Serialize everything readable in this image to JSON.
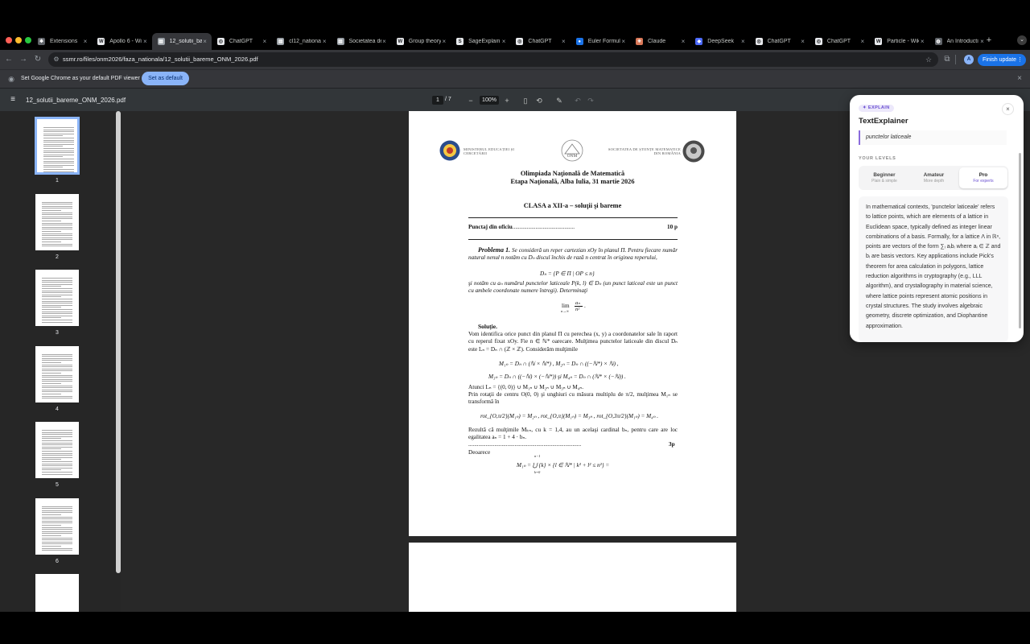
{
  "tabs": [
    {
      "title": "Extensions",
      "icon": "puzzle-icon",
      "active": false
    },
    {
      "title": "Apollo 6 - Wi",
      "icon": "wikipedia-icon",
      "active": false
    },
    {
      "title": "12_solutii_ba",
      "icon": "pdf-icon",
      "active": true
    },
    {
      "title": "ChatGPT",
      "icon": "chatgpt-icon",
      "active": false
    },
    {
      "title": "cl12_nationa",
      "icon": "pdf-icon",
      "active": false
    },
    {
      "title": "Societatea de",
      "icon": "pdf-icon",
      "active": false
    },
    {
      "title": "Group theory",
      "icon": "wikipedia-icon",
      "active": false
    },
    {
      "title": "SageExplain",
      "icon": "sage-icon",
      "active": false
    },
    {
      "title": "ChatGPT",
      "icon": "chatgpt-icon",
      "active": false
    },
    {
      "title": "Euler Formul",
      "icon": "site-icon",
      "active": false
    },
    {
      "title": "Claude",
      "icon": "claude-icon",
      "active": false
    },
    {
      "title": "DeepSeek",
      "icon": "deepseek-icon",
      "active": false
    },
    {
      "title": "ChatGPT",
      "icon": "chatgpt-icon",
      "active": false
    },
    {
      "title": "ChatGPT",
      "icon": "chatgpt-icon",
      "active": false
    },
    {
      "title": "Particle - Wik",
      "icon": "wikipedia-icon",
      "active": false
    },
    {
      "title": "An Introducti",
      "icon": "globe-icon",
      "active": false
    }
  ],
  "toolbar": {
    "url": "ssmr.ro/files/onm2026/faza_nationala/12_solutii_bareme_ONM_2026.pdf",
    "finish_update": "Finish update",
    "profile_initial": "A"
  },
  "infobar": {
    "text": "Set Google Chrome as your default PDF viewer",
    "button": "Set as default"
  },
  "pdf": {
    "filename": "12_solutii_bareme_ONM_2026.pdf",
    "page_current": "1",
    "page_total": "/ 7",
    "zoom": "100%",
    "thumbnails": [
      "1",
      "2",
      "3",
      "4",
      "5",
      "6"
    ]
  },
  "document": {
    "ministry": "MINISTERUL EDUCAȚIEI ȘI CERCETĂRII",
    "society": "SOCIETATEA DE ȘTIINȚE MATEMATICE DIN ROMÂNIA",
    "onm_logo": "ONM",
    "title1": "Olimpiada Naţională de Matematică",
    "title2": "Etapa Naţională, Alba Iulia, 31 martie 2026",
    "class_title": "CLASA a XII-a – soluţii şi bareme",
    "oficiu": "Punctaj din oficiu",
    "oficiu_dots": "...........................................",
    "oficiu_pts": "10 p",
    "problem_label": "Problema 1.",
    "problem_text": "Se consideră un reper cartezian xOy în planul Π. Pentru fiecare număr natural nenul n notăm cu Dₙ discul închis de rază n centrat în originea reperului,",
    "problem_eq": "Dₙ = {P ∈ Π | OP ≤ n}",
    "problem_text2": "şi notăm cu aₙ numărul punctelor laticeale P(k, l) ∈ Dₙ (un punct laticeal este un punct cu ambele coordonate numere întregi). Determinaţi",
    "problem_lim": "lim",
    "problem_lim_sub": "n→∞",
    "problem_frac_num": "aₙ",
    "problem_frac_den": "n²",
    "problem_frac_tail": ".",
    "solution_label": "Soluţie.",
    "solution_text": "Vom identifica orice punct din planul Π cu perechea (x, y) a coordonatelor sale în raport cu reperul fixat xOy. Fie n ∈ ℕ* oarecare. Mulţimea punctelor laticeale din discul Dₙ este Lₙ = Dₙ ∩ (ℤ × ℤ). Considerăm mulţimile",
    "eq_m1": "M₁ₙ = Dₙ ∩ (ℕ × ℕ*) ,        M₂ₙ = Dₙ ∩ ((−ℕ*) × ℕ) ,",
    "eq_m3": "M₃ₙ = Dₙ ∩ ((−ℕ) × (−ℕ*))   şi   M₄ₙ = Dₙ ∩ (ℕ* × (−ℕ)) .",
    "eq_l": "Atunci Lₙ = {(0, 0)} ∪ M₁ₙ ∪ M₂ₙ ∪ M₃ₙ ∪ M₄ₙ.",
    "rot_text": "Prin rotaţii de centru O(0, 0) şi unghiuri cu măsura multiplu de π/2, mulţimea M₁ₙ se transformă în",
    "eq_rot": "rot_{O,π/2}(M₁ₙ) = M₂ₙ ,   rot_{O,π}(M₁ₙ) = M₃ₙ ,   rot_{O,3π/2}(M₁ₙ) = M₄ₙ .",
    "result_text": "Rezultă că mulţimile Mₖₙ, cu k = 1,4, au un acelaşi cardinal bₙ, pentru care are loc egalitatea aₙ = 1 + 4 · bₙ.",
    "result_dots": "..............................................................................",
    "result_pts": "3p",
    "deoarece": "Deoarece",
    "eq_union_top": "n−1",
    "eq_union": "M₁ₙ = ⋃ {k} × {l ∈ ℕ* | k² + l² ≤ n²} =",
    "eq_union_bot": "k=0"
  },
  "explainer": {
    "badge": "✦ EXPLAIN",
    "title": "TextExplainer",
    "close": "×",
    "selected_text": "punctelor laticeale",
    "levels_label": "YOUR LEVELS",
    "levels": [
      {
        "name": "Beginner",
        "sub": "Plain & simple",
        "active": false
      },
      {
        "name": "Amateur",
        "sub": "More depth",
        "active": false
      },
      {
        "name": "Pro",
        "sub": "For experts",
        "active": true
      }
    ],
    "explanation": "In mathematical contexts, 'punctelor laticeale' refers to lattice points, which are elements of a lattice in Euclidean space, typically defined as integer linear combinations of a basis. Formally, for a lattice Λ in ℝⁿ, points are vectors of the form ∑ᵢ aᵢbᵢ where aᵢ ∈ ℤ and bᵢ are basis vectors. Key applications include Pick's theorem for area calculation in polygons, lattice reduction algorithms in cryptography (e.g., LLL algorithm), and crystallography in material science, where lattice points represent atomic positions in crystal structures. The study involves algebraic geometry, discrete optimization, and Diophantine approximation."
  },
  "colors": {
    "accent": "#8ab4f8",
    "update_button": "#1a73e8",
    "explain_purple": "#6a4fd1",
    "tab_active": "#35363a"
  }
}
